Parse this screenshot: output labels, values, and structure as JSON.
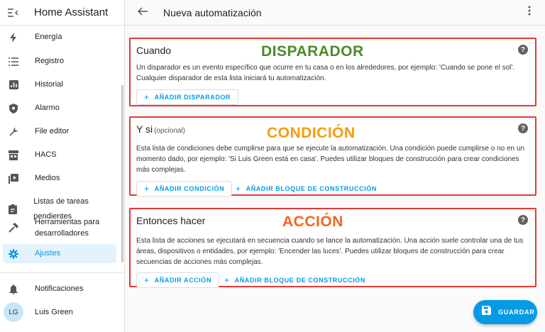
{
  "app": {
    "title": "Home Assistant"
  },
  "sidebar": {
    "items": [
      {
        "label": "Energía",
        "icon": "lightning-icon"
      },
      {
        "label": "Registro",
        "icon": "list-icon"
      },
      {
        "label": "Historial",
        "icon": "chart-icon"
      },
      {
        "label": "Alarmo",
        "icon": "shield-icon"
      },
      {
        "label": "File editor",
        "icon": "wrench-icon"
      },
      {
        "label": "HACS",
        "icon": "store-icon"
      },
      {
        "label": "Medios",
        "icon": "media-icon"
      },
      {
        "label": "Listas de tareas pendientes",
        "icon": "clipboard-icon"
      },
      {
        "label": "Herramientas para",
        "label2": "desarrolladores",
        "icon": "hammer-icon"
      },
      {
        "label": "Ajustes",
        "icon": "gear-icon",
        "active": true
      }
    ],
    "notifications": {
      "label": "Notificaciones",
      "icon": "bell-icon"
    },
    "user": {
      "initials": "LG",
      "name": "Luis Green"
    }
  },
  "header": {
    "title": "Nueva automatización"
  },
  "sections": {
    "triggers": {
      "title": "Cuando",
      "overlay": "DISPARADOR",
      "overlay_color": "#4b8b2a",
      "description": "Un disparador es un evento específico que ocurre en tu casa o en los alrededores, por ejemplo: 'Cuando se pone el sol'. Cualquier disparador de esta lista iniciará tu automatización.",
      "add_button": "AÑADIR DISPARADOR"
    },
    "conditions": {
      "title": "Y si",
      "optional": "(opcional)",
      "overlay": "CONDICIÓN",
      "overlay_color": "#f39c12",
      "description": "Esta lista de condiciones debe cumplirse para que se ejecute la automatización. Una condición puede cumplirse o no en un momento dado, por ejemplo: 'Si Luis Green está en casa'. Puedes utilizar bloques de construcción para crear condiciones más complejas.",
      "add_button": "AÑADIR CONDICIÓN",
      "add_block_button": "AÑADIR BLOQUE DE CONSTRUCCIÓN"
    },
    "actions": {
      "title": "Entonces hacer",
      "overlay": "ACCIÓN",
      "overlay_color": "#f26522",
      "description": "Esta lista de acciones se ejecutará en secuencia cuando se lance la automatización. Una acción suele controlar una de tus áreas, dispositivos o entidades, por ejemplo: 'Encender las luces'. Puedes utilizar bloques de construcción para crear secuencias de acciones más complejas.",
      "add_button": "AÑADIR ACCIÓN",
      "add_block_button": "AÑADIR BLOQUE DE CONSTRUCCIÓN"
    }
  },
  "save_button": {
    "label": "GUARDAR",
    "icon": "save-icon"
  },
  "colors": {
    "accent": "#039be5",
    "highlight_border": "#e53935"
  }
}
